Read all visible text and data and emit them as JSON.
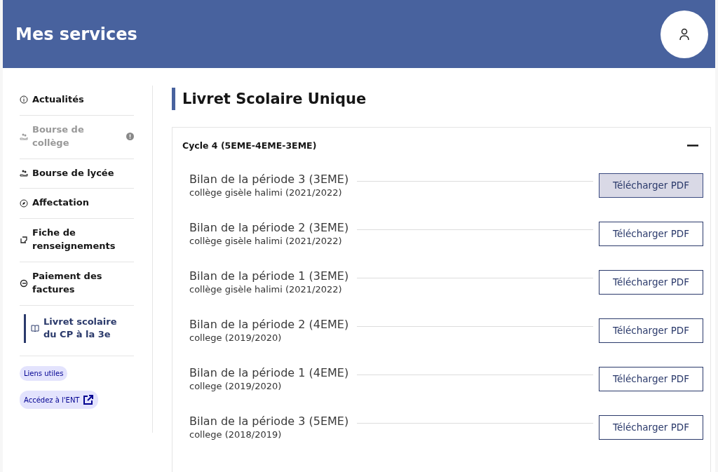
{
  "header": {
    "title": "Mes services"
  },
  "sidebar": {
    "items": [
      {
        "label": "Actualités",
        "disabled": false,
        "selected": false,
        "warning": false
      },
      {
        "label": "Bourse de collège",
        "disabled": true,
        "selected": false,
        "warning": true
      },
      {
        "label": "Bourse de lycée",
        "disabled": false,
        "selected": false,
        "warning": false
      },
      {
        "label": "Affectation",
        "disabled": false,
        "selected": false,
        "warning": false
      },
      {
        "label": "Fiche de renseignements",
        "disabled": false,
        "selected": false,
        "warning": false
      },
      {
        "label": "Paiement des factures",
        "disabled": false,
        "selected": false,
        "warning": false
      },
      {
        "label": "Livret scolaire du CP à la 3e",
        "disabled": false,
        "selected": true,
        "warning": false
      }
    ],
    "tags": [
      {
        "label": "Liens utiles",
        "external": false
      },
      {
        "label": "Accédez à l'ENT",
        "external": true
      }
    ]
  },
  "main": {
    "title": "Livret Scolaire Unique",
    "section": {
      "title": "Cycle 4 (5EME-4EME-3EME)",
      "expanded": true,
      "rows": [
        {
          "title": "Bilan de la période 3 (3EME)",
          "subtitle": "collège gisèle halimi (2021/2022)",
          "button": "Télécharger PDF",
          "hovered": true
        },
        {
          "title": "Bilan de la période 2 (3EME)",
          "subtitle": "collège gisèle halimi (2021/2022)",
          "button": "Télécharger PDF",
          "hovered": false
        },
        {
          "title": "Bilan de la période 1 (3EME)",
          "subtitle": "collège gisèle halimi (2021/2022)",
          "button": "Télécharger PDF",
          "hovered": false
        },
        {
          "title": "Bilan de la période 2 (4EME)",
          "subtitle": "college (2019/2020)",
          "button": "Télécharger PDF",
          "hovered": false
        },
        {
          "title": "Bilan de la période 1 (4EME)",
          "subtitle": "college (2019/2020)",
          "button": "Télécharger PDF",
          "hovered": false
        },
        {
          "title": "Bilan de la période 3 (5EME)",
          "subtitle": "college (2018/2019)",
          "button": "Télécharger PDF",
          "hovered": false
        }
      ]
    }
  }
}
